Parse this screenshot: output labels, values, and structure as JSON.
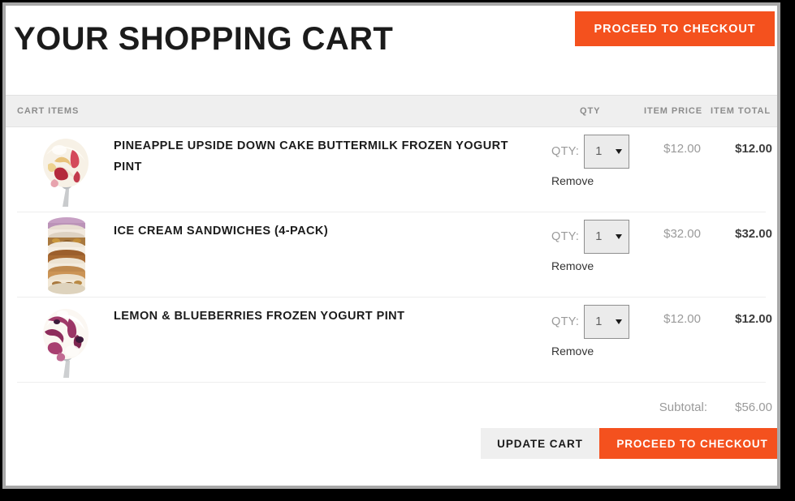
{
  "window": {
    "frame_border_color": "#a8a8a8",
    "background": "#ffffff"
  },
  "header": {
    "title": "YOUR SHOPPING CART",
    "checkout_top_label": "PROCEED TO CHECKOUT"
  },
  "theme": {
    "accent_orange": "#f4511e",
    "header_bar_gray": "#efefef",
    "muted_text": "#9a9a9a",
    "dark_text": "#1b1b1b"
  },
  "table": {
    "columns": {
      "items": "CART ITEMS",
      "qty": "QTY",
      "item_price": "ITEM PRICE",
      "item_total": "ITEM TOTAL"
    },
    "qty_field_label": "QTY:",
    "remove_label": "Remove",
    "rows": [
      {
        "title": "PINEAPPLE UPSIDE DOWN CAKE BUTTERMILK FROZEN YOGURT PINT",
        "qty": "1",
        "item_price": "$12.00",
        "item_total": "$12.00",
        "thumb": "frozen-yogurt-scoop-pineapple"
      },
      {
        "title": "ICE CREAM SANDWICHES (4-PACK)",
        "qty": "1",
        "item_price": "$32.00",
        "item_total": "$32.00",
        "thumb": "ice-cream-sandwich-stack"
      },
      {
        "title": "LEMON & BLUEBERRIES FROZEN YOGURT PINT",
        "qty": "1",
        "item_price": "$12.00",
        "item_total": "$12.00",
        "thumb": "frozen-yogurt-scoop-blueberry"
      }
    ]
  },
  "summary": {
    "subtotal_label": "Subtotal:",
    "subtotal_value": "$56.00"
  },
  "footer": {
    "update_cart_label": "UPDATE CART",
    "checkout_label": "PROCEED TO CHECKOUT"
  }
}
